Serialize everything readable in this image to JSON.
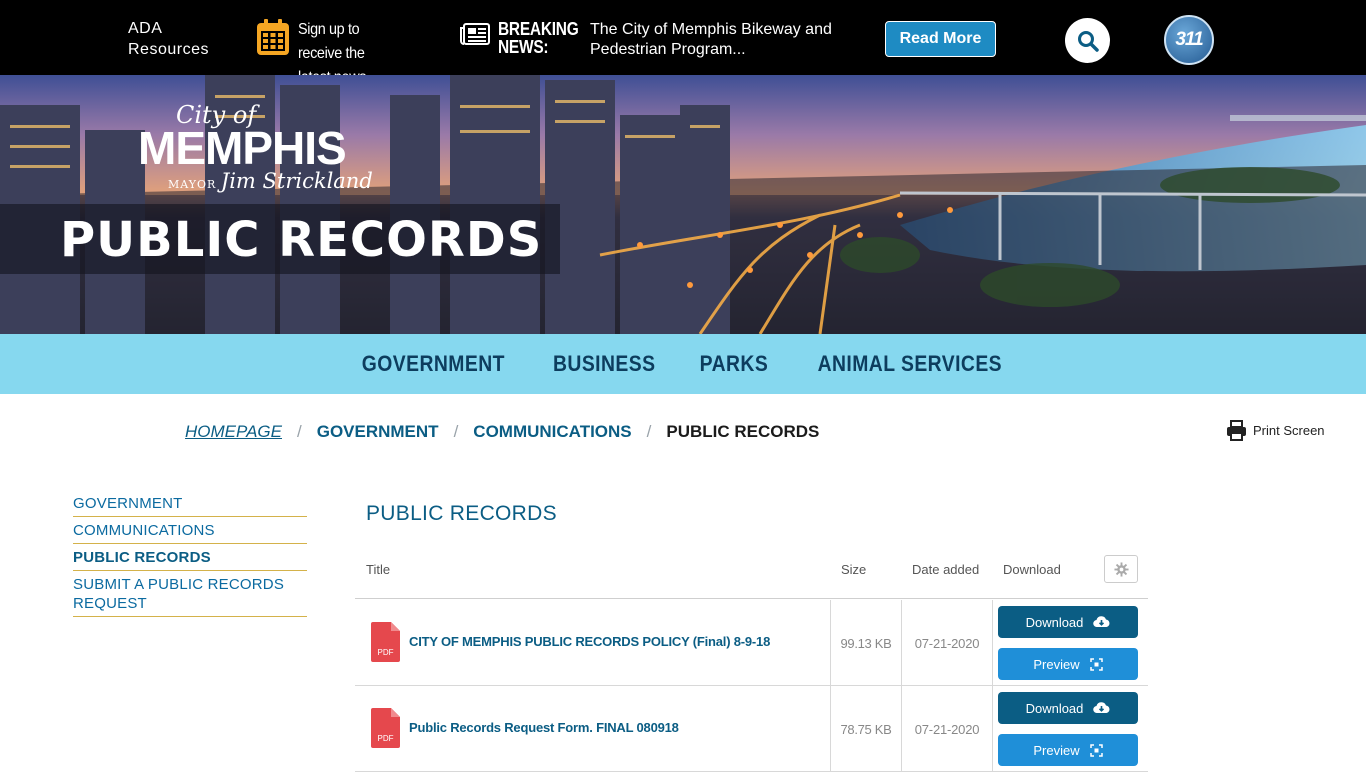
{
  "topbar": {
    "ada_label": "ADA Resources",
    "signup_label": "Sign up to receive the latest news",
    "breaking_label": "BREAKING NEWS:",
    "breaking_text": "The City of Memphis Bikeway and Pedestrian Program...",
    "read_more": "Read More",
    "badge_311": "311"
  },
  "hero": {
    "logo_cityof": "City of",
    "logo_memphis": "MEMPHIS",
    "logo_mayor": "MAYOR",
    "logo_name": "Jim Strickland",
    "page_title": "PUBLIC RECORDS"
  },
  "nav": {
    "items": [
      "GOVERNMENT",
      "BUSINESS",
      "PARKS",
      "ANIMAL SERVICES"
    ]
  },
  "breadcrumb": {
    "home": "HOMEPAGE",
    "level1": "GOVERNMENT",
    "level2": "COMMUNICATIONS",
    "current": "PUBLIC RECORDS",
    "separator": "/"
  },
  "print_label": "Print Screen",
  "sidebar": {
    "items": [
      "GOVERNMENT",
      "COMMUNICATIONS",
      "PUBLIC RECORDS",
      "SUBMIT A PUBLIC RECORDS REQUEST"
    ]
  },
  "main": {
    "title": "PUBLIC RECORDS",
    "columns": {
      "title": "Title",
      "size": "Size",
      "date": "Date added",
      "download": "Download"
    },
    "rows": [
      {
        "title": "CITY OF MEMPHIS PUBLIC RECORDS POLICY (Final) 8-9-18",
        "size": "99.13 KB",
        "date": "07-21-2020",
        "download": "Download",
        "preview": "Preview",
        "file_badge": "PDF"
      },
      {
        "title": "Public Records Request Form. FINAL 080918",
        "size": "78.75 KB",
        "date": "07-21-2020",
        "download": "Download",
        "preview": "Preview",
        "file_badge": "PDF"
      }
    ]
  },
  "colors": {
    "topbar_bg": "#000000",
    "nav_bg": "#86d8ef",
    "link_blue": "#0b5d84",
    "download_btn": "#0b5d84",
    "preview_btn": "#1f8fd8",
    "pdf_red": "#e5484d",
    "sidebar_rule": "#d4b24a"
  },
  "icons": [
    "calendar-icon",
    "newspaper-icon",
    "search-icon",
    "311-badge",
    "printer-icon",
    "gear-icon",
    "pdf-file-icon",
    "cloud-download-icon",
    "preview-icon"
  ]
}
